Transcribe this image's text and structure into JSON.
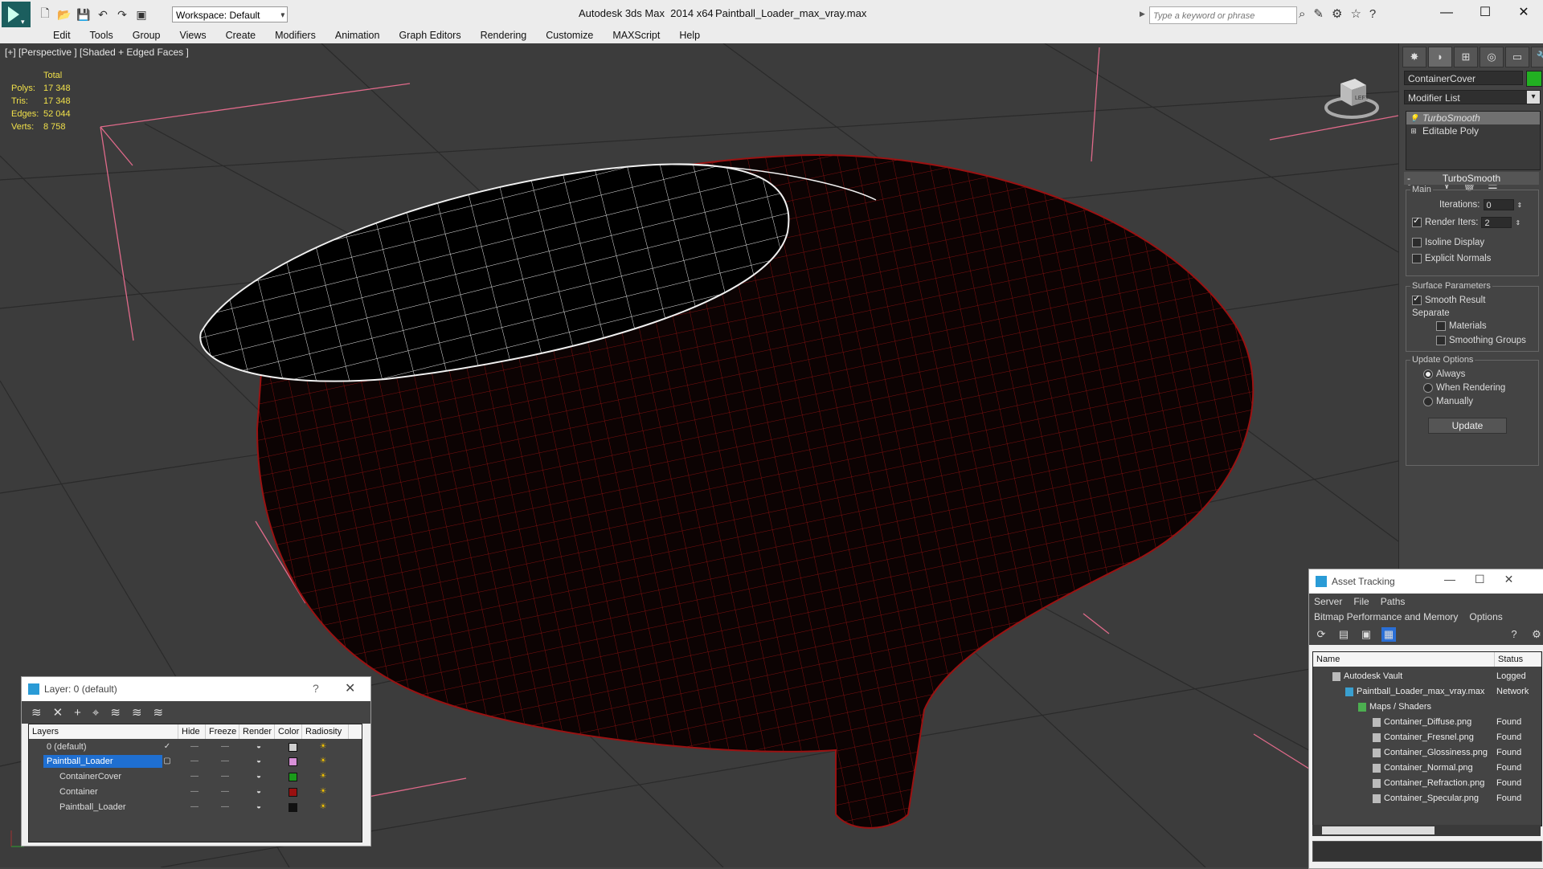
{
  "title_bar": {
    "workspace": "Workspace: Default",
    "app_title": "Autodesk 3ds Max  2014 x64",
    "file_title": "Paintball_Loader_max_vray.max",
    "search_placeholder": "Type a keyword or phrase",
    "window_controls": [
      "—",
      "☐",
      "✕"
    ]
  },
  "menu": [
    "Edit",
    "Tools",
    "Group",
    "Views",
    "Create",
    "Modifiers",
    "Animation",
    "Graph Editors",
    "Rendering",
    "Customize",
    "MAXScript",
    "Help"
  ],
  "viewport": {
    "label": "[+] [Perspective ] [Shaded + Edged Faces ]",
    "stats": {
      "header": "Total",
      "rows": [
        {
          "key": "Polys:",
          "value": "17 348"
        },
        {
          "key": "Tris:",
          "value": "17 348"
        },
        {
          "key": "Edges:",
          "value": "52 044"
        },
        {
          "key": "Verts:",
          "value": "8 758"
        }
      ]
    },
    "viewcube_label": "LEFT"
  },
  "command_panel": {
    "object_name": "ContainerCover",
    "object_color": "#22b022",
    "modifier_list": "Modifier List",
    "stack": [
      "TurboSmooth",
      "Editable Poly"
    ],
    "rollout_title": "TurboSmooth",
    "main_group": "Main",
    "iterations_label": "Iterations:",
    "iterations_value": "0",
    "render_iters_label": "Render Iters:",
    "render_iters_value": "2",
    "isoline_display": "Isoline Display",
    "explicit_normals": "Explicit Normals",
    "surface_group": "Surface Parameters",
    "smooth_result": "Smooth Result",
    "separate": "Separate",
    "materials": "Materials",
    "smoothing_groups": "Smoothing Groups",
    "update_group": "Update Options",
    "always": "Always",
    "when_rendering": "When Rendering",
    "manually": "Manually",
    "update_button": "Update"
  },
  "layer_manager": {
    "title": "Layer: 0 (default)",
    "help": "?",
    "columns": [
      "Layers",
      "Hide",
      "Freeze",
      "Render",
      "Color",
      "Radiosity"
    ],
    "rows": [
      {
        "name": "0 (default)",
        "color": "#d0d0d0"
      },
      {
        "name": "Paintball_Loader",
        "color": "#d890d8"
      },
      {
        "name": "ContainerCover",
        "color": "#1a9a1a"
      },
      {
        "name": "Container",
        "color": "#9a1010"
      },
      {
        "name": "Paintball_Loader",
        "color": "#111111"
      }
    ]
  },
  "asset_tracking": {
    "title": "Asset Tracking",
    "menu1": [
      "Server",
      "File",
      "Paths"
    ],
    "menu2": [
      "Bitmap Performance and Memory",
      "Options"
    ],
    "columns": [
      "Name",
      "Status"
    ],
    "rows": [
      {
        "name": "Autodesk Vault",
        "status": "Logged"
      },
      {
        "name": "Paintball_Loader_max_vray.max",
        "status": "Network"
      },
      {
        "name": "Maps / Shaders",
        "status": ""
      },
      {
        "name": "Container_Diffuse.png",
        "status": "Found"
      },
      {
        "name": "Container_Fresnel.png",
        "status": "Found"
      },
      {
        "name": "Container_Glossiness.png",
        "status": "Found"
      },
      {
        "name": "Container_Normal.png",
        "status": "Found"
      },
      {
        "name": "Container_Refraction.png",
        "status": "Found"
      },
      {
        "name": "Container_Specular.png",
        "status": "Found"
      }
    ]
  }
}
